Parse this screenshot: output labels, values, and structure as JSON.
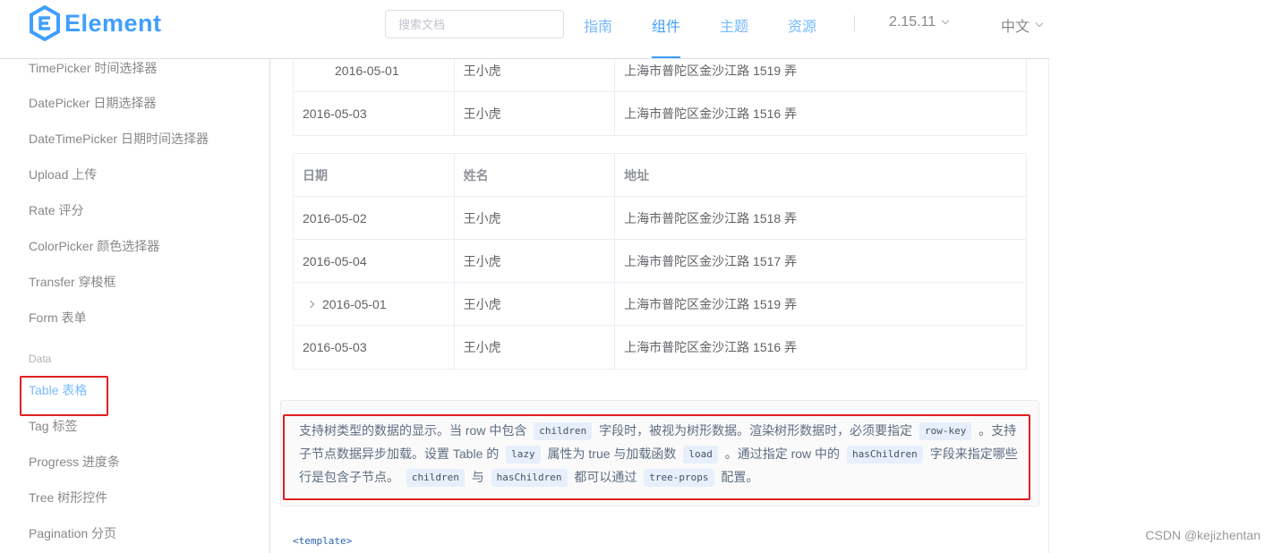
{
  "header": {
    "logo_text": "Element",
    "search_placeholder": "搜索文档",
    "nav": [
      "指南",
      "组件",
      "主题",
      "资源"
    ],
    "version": "2.15.11",
    "language": "中文"
  },
  "sidebar": {
    "items": [
      "TimePicker 时间选择器",
      "DatePicker 日期选择器",
      "DateTimePicker 日期时间选择器",
      "Upload 上传",
      "Rate 评分",
      "ColorPicker 颜色选择器",
      "Transfer 穿梭框",
      "Form 表单"
    ],
    "group_data": "Data",
    "data_items": [
      "Table 表格",
      "Tag 标签",
      "Progress 进度条",
      "Tree 树形控件",
      "Pagination 分页"
    ]
  },
  "table1": {
    "rows": [
      {
        "date": "2016-05-01",
        "name": "王小虎",
        "address": "上海市普陀区金沙江路 1519 弄"
      },
      {
        "date": "2016-05-03",
        "name": "王小虎",
        "address": "上海市普陀区金沙江路 1516 弄"
      }
    ]
  },
  "table2": {
    "headers": {
      "date": "日期",
      "name": "姓名",
      "address": "地址"
    },
    "rows": [
      {
        "date": "2016-05-02",
        "name": "王小虎",
        "address": "上海市普陀区金沙江路 1518 弄"
      },
      {
        "date": "2016-05-04",
        "name": "王小虎",
        "address": "上海市普陀区金沙江路 1517 弄"
      },
      {
        "date": "2016-05-01",
        "name": "王小虎",
        "address": "上海市普陀区金沙江路 1519 弄"
      },
      {
        "date": "2016-05-03",
        "name": "王小虎",
        "address": "上海市普陀区金沙江路 1516 弄"
      }
    ]
  },
  "description": {
    "t1": "支持树类型的数据的显示。当 row 中包含",
    "code1": "children",
    "t2": "字段时，被视为树形数据。渲染树形数据时，必须要指定",
    "code2": "row-key",
    "t3": "。支持子节点数据异步加载。设置 Table 的",
    "code3": "lazy",
    "t4": "属性为 true 与加载函数",
    "code4": "load",
    "t5": "。通过指定 row 中的",
    "code5": "hasChildren",
    "t6": "字段来指定哪些行是包含子节点。",
    "code6": "children",
    "t7": "与",
    "code7": "hasChildren",
    "t8": "都可以通过",
    "code8": "tree-props",
    "t9": "配置。"
  },
  "code_preview": "<template>",
  "watermark": "CSDN @kejizhentan",
  "colors": {
    "accent": "#409eff",
    "highlight": "#e01f1f"
  }
}
